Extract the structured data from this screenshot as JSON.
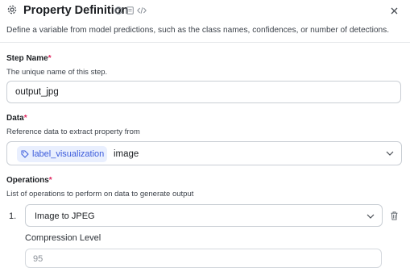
{
  "header": {
    "title": "Property Definition",
    "subtitle": "Define a variable from model predictions, such as the class names, confidences, or number of detections.",
    "icons": [
      "gear-icon",
      "help-icon",
      "docs-icon",
      "code-icon",
      "close-icon"
    ]
  },
  "step_name": {
    "label": "Step Name",
    "required_marker": "*",
    "description": "The unique name of this step.",
    "value": "output_jpg"
  },
  "data": {
    "label": "Data",
    "required_marker": "*",
    "description": "Reference data to extract property from",
    "chip_label": "label_visualization",
    "value": "image",
    "chip_color": "#3b5bdb"
  },
  "operations": {
    "label": "Operations",
    "required_marker": "*",
    "description": "List of operations to perform on data to generate output",
    "items": [
      {
        "index": "1.",
        "operation": "Image to JPEG",
        "param_label": "Compression Level",
        "param_placeholder": "95"
      }
    ]
  },
  "colors": {
    "required": "#e0245e",
    "chip_bg": "#e9effe",
    "border": "#c9ced4"
  }
}
